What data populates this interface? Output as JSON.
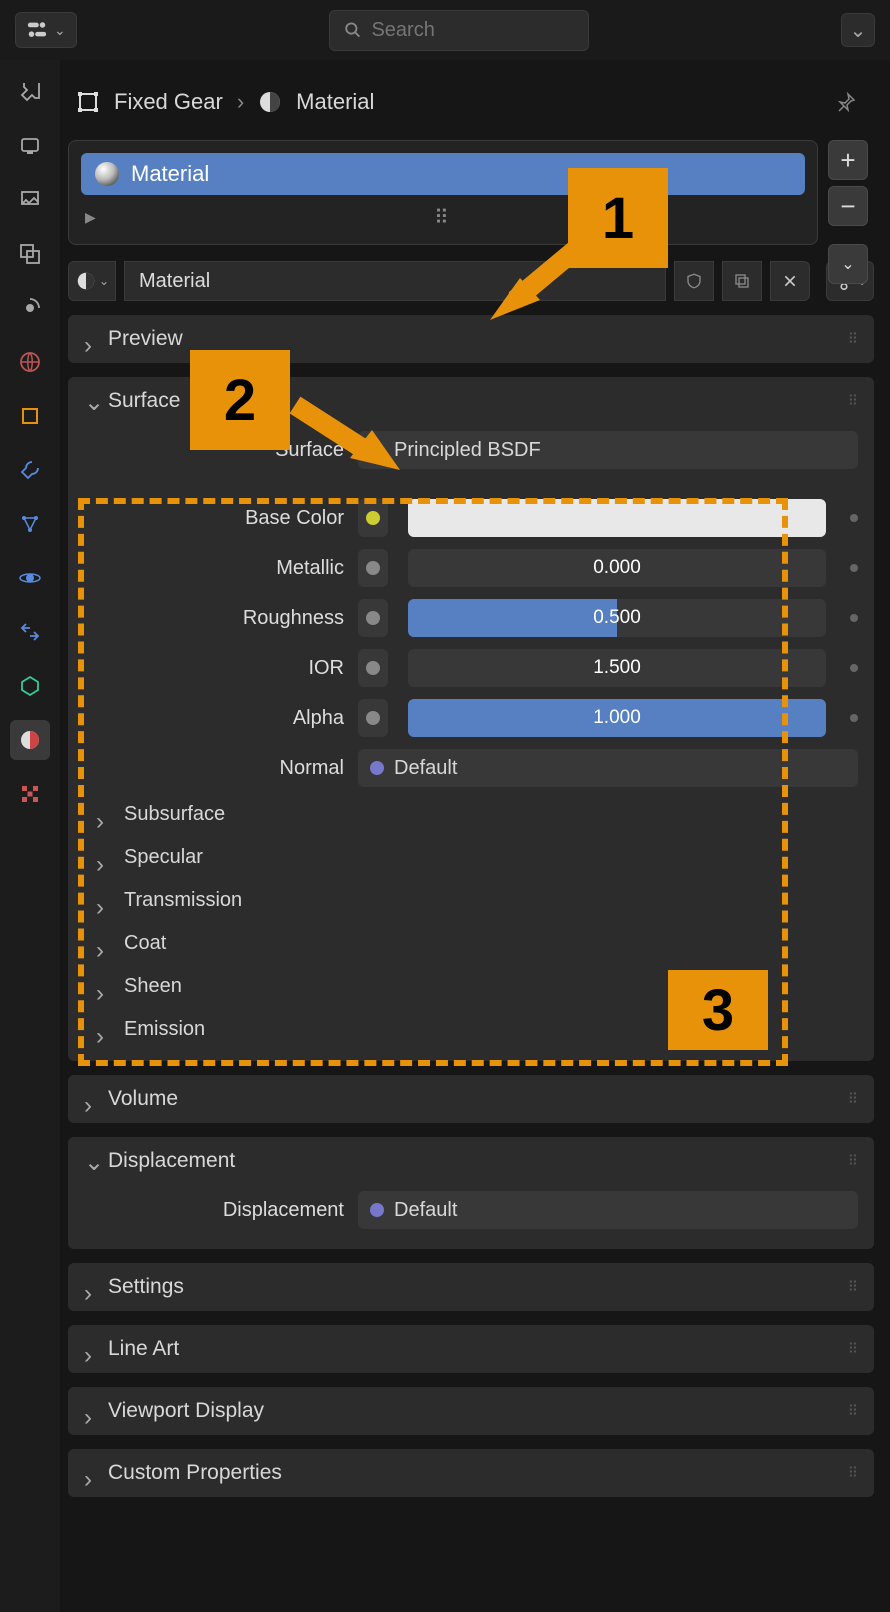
{
  "header": {
    "search_placeholder": "Search"
  },
  "breadcrumb": {
    "object": "Fixed Gear",
    "material": "Material"
  },
  "material_list": {
    "active": "Material"
  },
  "material_name": "Material",
  "panels": {
    "preview": "Preview",
    "surface": "Surface",
    "volume": "Volume",
    "displacement": "Displacement",
    "settings": "Settings",
    "line_art": "Line Art",
    "viewport_display": "Viewport Display",
    "custom_properties": "Custom Properties"
  },
  "surface": {
    "surface_label": "Surface",
    "surface_value": "Principled BSDF",
    "base_color_label": "Base Color",
    "base_color_value": "#e8e8e8",
    "metallic_label": "Metallic",
    "metallic_value": "0.000",
    "roughness_label": "Roughness",
    "roughness_value": "0.500",
    "ior_label": "IOR",
    "ior_value": "1.500",
    "alpha_label": "Alpha",
    "alpha_value": "1.000",
    "normal_label": "Normal",
    "normal_value": "Default",
    "sub_panels": [
      "Subsurface",
      "Specular",
      "Transmission",
      "Coat",
      "Sheen",
      "Emission"
    ]
  },
  "displacement": {
    "label": "Displacement",
    "value": "Default"
  },
  "annotations": {
    "one": "1",
    "two": "2",
    "three": "3"
  }
}
